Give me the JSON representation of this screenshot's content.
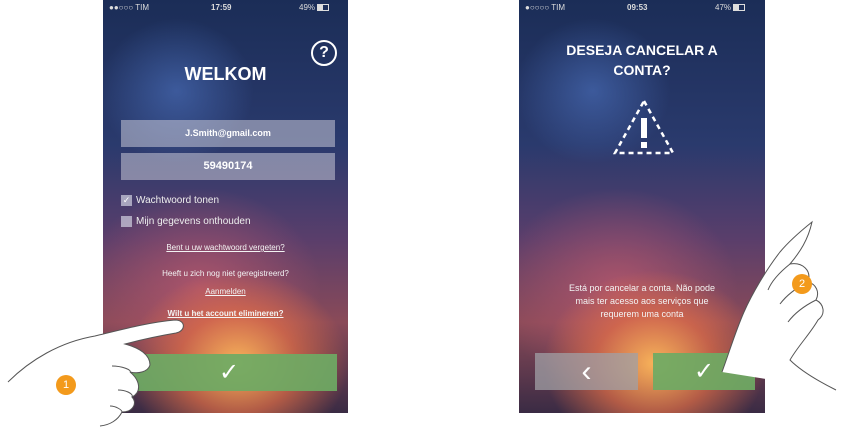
{
  "screen1": {
    "status": {
      "carrier": "●●○○○ TIM",
      "time": "17:59",
      "battery": "49%"
    },
    "help_label": "?",
    "title": "WELKOM",
    "email": "J.Smith@gmail.com",
    "password": "59490174",
    "show_password": {
      "label": "Wachtwoord tonen",
      "checked": true,
      "mark": "✓"
    },
    "remember_me": {
      "label": "Mijn gegevens onthouden",
      "checked": false
    },
    "forgot_link": "Bent u uw wachtwoord vergeten?",
    "not_registered": "Heeft u zich nog niet geregistreerd?",
    "register_link": "Aanmelden",
    "delete_account_link": "Wilt u het account elimineren?",
    "confirm_symbol": "✓"
  },
  "screen2": {
    "status": {
      "carrier": "●○○○○ TIM",
      "time": "09:53",
      "battery": "47%"
    },
    "title_line1": "DESEJA CANCELAR A",
    "title_line2": "CONTA?",
    "message_line1": "Está por cancelar a conta. Não pode",
    "message_line2": "mais ter acesso aos serviços que",
    "message_line3": "requerem uma conta",
    "back_symbol": "‹",
    "confirm_symbol": "✓"
  },
  "callouts": {
    "step1": "1",
    "step2": "2"
  },
  "colors": {
    "accent_orange": "#f39a1c",
    "confirm_green": "#6eaa64",
    "field_gray": "#c8c8d7"
  }
}
